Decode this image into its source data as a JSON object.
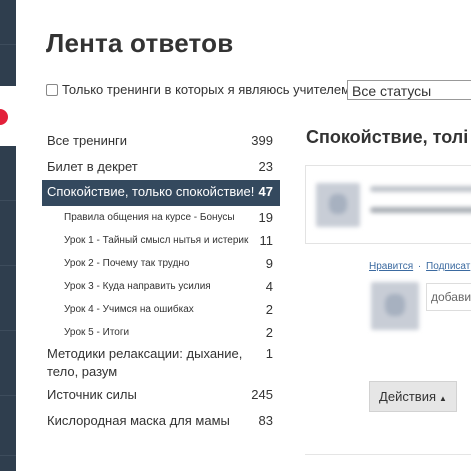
{
  "page": {
    "title": "Лента ответов"
  },
  "filter": {
    "checkbox_label": "Только тренинги в которых я являюсь учителем",
    "status_select": "Все статусы"
  },
  "trainings": [
    {
      "label": "Все тренинги",
      "count": "399"
    },
    {
      "label": "Билет в декрет",
      "count": "23"
    },
    {
      "label": "Спокойствие, только спокойствие!",
      "count": "47",
      "active": true
    },
    {
      "label": "Правила общения на курсе - Бонусы",
      "count": "19",
      "sub": true
    },
    {
      "label": "Урок 1 - Тайный смысл нытья и истерик",
      "count": "11",
      "sub": true
    },
    {
      "label": "Урок 2 - Почему так трудно",
      "count": "9",
      "sub": true
    },
    {
      "label": "Урок 3 - Куда направить усилия",
      "count": "4",
      "sub": true
    },
    {
      "label": "Урок 4 - Учимся на ошибках",
      "count": "2",
      "sub": true
    },
    {
      "label": "Урок 5 - Итоги",
      "count": "2",
      "sub": true
    },
    {
      "label": "Методики релаксации: дыхание, тело, разум",
      "count": "1"
    },
    {
      "label": "Источник силы",
      "count": "245"
    },
    {
      "label": "Кислородная маска для мамы",
      "count": "83"
    }
  ],
  "main": {
    "title": "Спокойствие, толі",
    "like_link": "Нравится",
    "subscribe_link": "Подписат",
    "reply_placeholder": "добави",
    "actions_label": "Действия",
    "actions_caret": "▲"
  },
  "colors": {
    "active_bg": "#34495e",
    "sidebar_bg": "#2f3e4e",
    "link": "#3b6aa0",
    "badge_red": "#e3203a"
  }
}
